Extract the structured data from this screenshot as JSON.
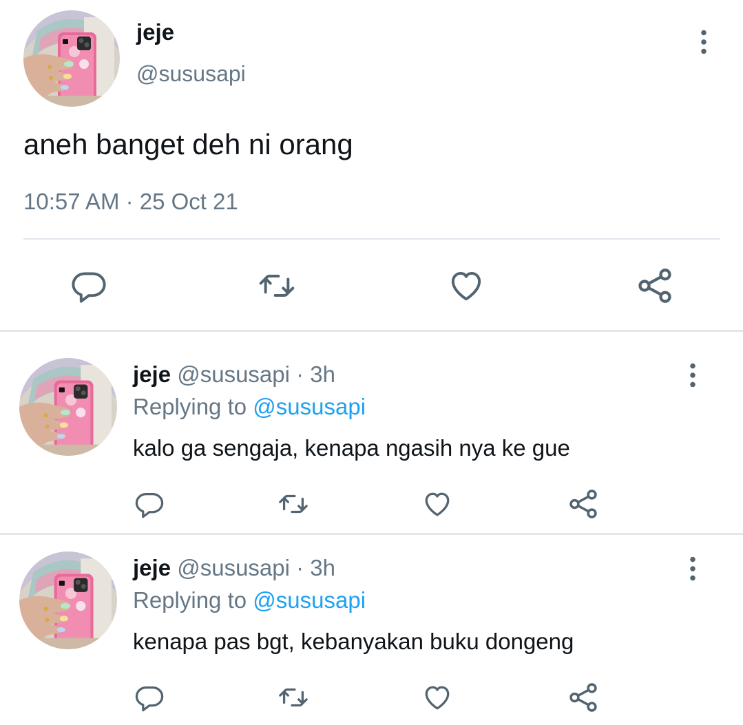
{
  "colors": {
    "text": "#0f1419",
    "muted": "#657786",
    "link": "#1da1f2",
    "icon": "#536471",
    "divider": "#e1e8ed"
  },
  "main_tweet": {
    "display_name": "jeje",
    "handle": "@sususapi",
    "text": "aneh banget deh ni orang",
    "timestamp": "10:57 AM · 25 Oct 21",
    "actions": [
      "reply-icon",
      "retweet-icon",
      "like-icon",
      "share-icon"
    ]
  },
  "replies": [
    {
      "display_name": "jeje",
      "meta": "@sususapi · 3h",
      "replying_prefix": "Replying to",
      "replying_handle": "@sususapi",
      "text": "kalo ga sengaja, kenapa ngasih nya ke gue"
    },
    {
      "display_name": "jeje",
      "meta": "@sususapi · 3h",
      "replying_prefix": "Replying to",
      "replying_handle": "@sususapi",
      "text": "kenapa pas bgt, kebanyakan buku dongeng"
    }
  ]
}
